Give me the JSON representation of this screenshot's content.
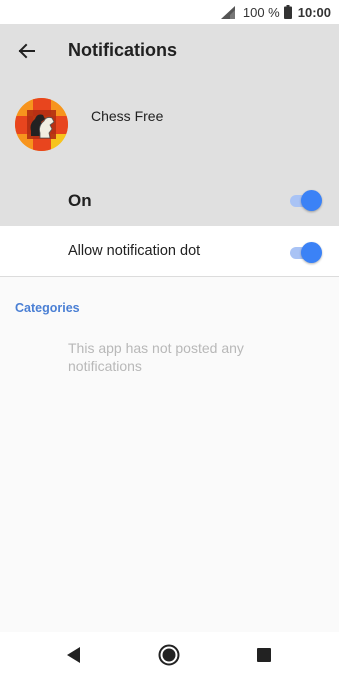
{
  "status_bar": {
    "battery_text": "100 %",
    "time": "10:00",
    "signal_icon": "signal-icon",
    "battery_icon": "battery-icon"
  },
  "header": {
    "title": "Notifications",
    "back_icon": "arrow-left-icon"
  },
  "app": {
    "name": "Chess Free",
    "icon": "chess-app-icon"
  },
  "on_toggle": {
    "label": "On",
    "checked": true
  },
  "notification_dot": {
    "label": "Allow notification dot",
    "checked": true
  },
  "categories": {
    "heading": "Categories",
    "empty_message": "This app has not posted any notifications"
  },
  "nav_bar": {
    "back_icon": "nav-back-icon",
    "home_icon": "nav-home-icon",
    "recent_icon": "nav-recent-apps-icon"
  },
  "colors": {
    "accent": "#3b82f6",
    "header_bg": "#e0e0e0",
    "category_text": "#4a7fd4"
  }
}
